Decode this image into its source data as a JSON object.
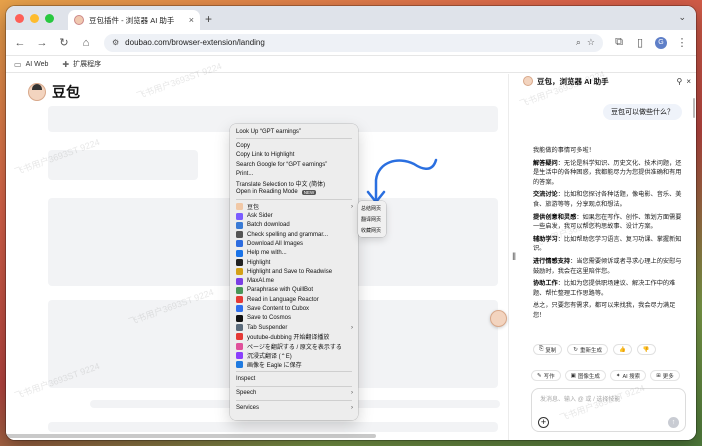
{
  "tab": {
    "title": "豆包插件 - 浏览器 AI 助手",
    "close": "×",
    "new_tab": "+"
  },
  "toolbar": {
    "url": "doubao.com/browser-extension/landing",
    "profile_initial": "G"
  },
  "bookmarks": [
    {
      "label": "AI Web",
      "icon": "folder-icon"
    },
    {
      "label": "扩展程序",
      "icon": "puzzle-icon"
    }
  ],
  "page": {
    "brand": "豆包",
    "watermark": "飞书用户3693ST 9224"
  },
  "context_menu": {
    "group1": [
      "Look Up “GPT earnings”"
    ],
    "group2": [
      "Copy",
      "Copy Link to Highlight",
      "Search Google for “GPT earnings”",
      "Print...",
      "Translate Selection to 中文 (简体)"
    ],
    "reading_mode": "Open in Reading Mode",
    "new_badge": "NEW",
    "extensions": [
      {
        "label": "豆包",
        "submenu": true,
        "color": "#f1c8a6"
      },
      {
        "label": "Ask Sider",
        "submenu": false,
        "color": "#7b5cff"
      },
      {
        "label": "Batch download",
        "submenu": false,
        "color": "#3a7bd5"
      },
      {
        "label": "Check spelling and grammar...",
        "submenu": false,
        "color": "#555555"
      },
      {
        "label": "Download All Images",
        "submenu": false,
        "color": "#2d6cdf"
      },
      {
        "label": "Help me with...",
        "submenu": false,
        "color": "#1a73e8"
      },
      {
        "label": "Highlight",
        "submenu": false,
        "color": "#222222"
      },
      {
        "label": "Highlight and Save to Readwise",
        "submenu": false,
        "color": "#d4a017"
      },
      {
        "label": "MaxAI.me",
        "submenu": false,
        "color": "#7b3fe4"
      },
      {
        "label": "Paraphrase with QuillBot",
        "submenu": false,
        "color": "#499557"
      },
      {
        "label": "Read in Language Reactor",
        "submenu": false,
        "color": "#e53935"
      },
      {
        "label": "Save Content to Cubox",
        "submenu": false,
        "color": "#2f6fed"
      },
      {
        "label": "Save to Cosmos",
        "submenu": false,
        "color": "#111111"
      },
      {
        "label": "Tab Suspender",
        "submenu": true,
        "color": "#5b6b7b"
      },
      {
        "label": "youtube-dubbing 开始翻译播放",
        "submenu": false,
        "color": "#e53935"
      },
      {
        "label": "ページを翻訳する / 原文を表示する",
        "submenu": false,
        "color": "#e0519b"
      },
      {
        "label": "沉浸式翻译 (⌃E)",
        "submenu": false,
        "color": "#8a3ffc"
      },
      {
        "label": "画像を Eagle に保存",
        "submenu": false,
        "color": "#1f7ae0"
      }
    ],
    "inspect": "Inspect",
    "speech": "Speech",
    "services": "Services"
  },
  "submenu": [
    "总结网页",
    "翻译网页",
    "收藏网页"
  ],
  "panel": {
    "title": "豆包，浏览器 AI 助手",
    "user_message": "豆包可以做些什么？",
    "answer_intro": "我能做的事情可多啦！",
    "answer_items": [
      {
        "head": "解答疑问",
        "body": "：无论是科学知识、历史文化、技术问题，还是生活中的各种困惑，我都能尽力为您提供准确和有用的答案。"
      },
      {
        "head": "交流讨论",
        "body": "：比如和您探讨各种话题，像电影、音乐、美食、旅游等等，分享观点和想法。"
      },
      {
        "head": "提供创意和灵感",
        "body": "：如果您在写作、创作、策划方面需要一些启发，我可以帮您构思故事、设计方案。"
      },
      {
        "head": "辅助学习",
        "body": "：比如帮助您学习语言、复习功课、掌握新知识。"
      },
      {
        "head": "进行情感支持",
        "body": "：当您需要倾诉或者寻求心理上的安慰与鼓励时，我会在这里陪伴您。"
      },
      {
        "head": "协助工作",
        "body": "：比如为您提供职场建议、解决工作中的难题、帮忙整理工作思路等。"
      }
    ],
    "answer_outro": "总之，只要您有需求，都可以来找我，我会尽力满足您！",
    "actions": [
      "复制",
      "重新生成"
    ],
    "quick_actions": [
      "写作",
      "图像生成",
      "AI 搜索",
      "更多"
    ],
    "input_placeholder": "发消息、输入 @ 或 / 选择技能"
  }
}
